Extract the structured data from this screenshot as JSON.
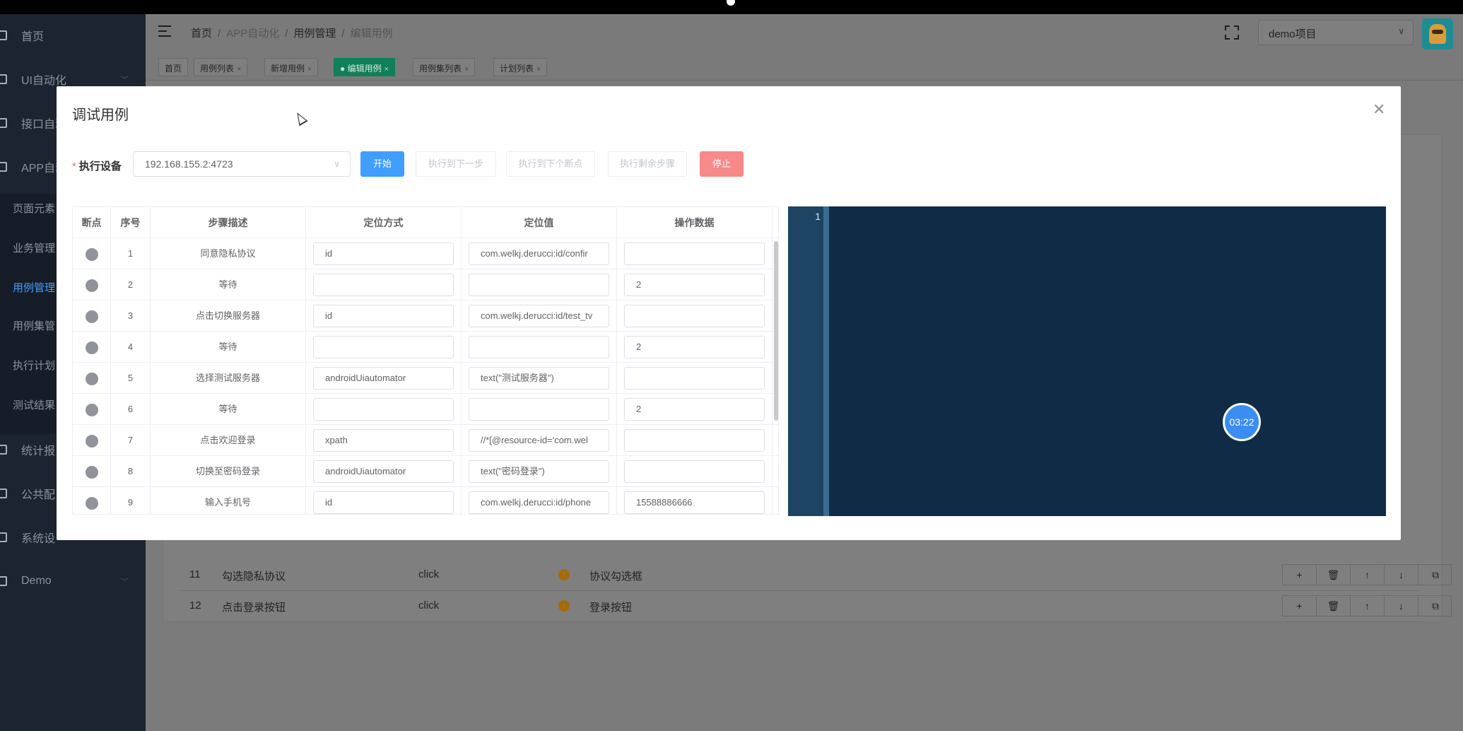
{
  "header": {
    "breadcrumb": [
      "首页",
      "APP自动化",
      "用例管理",
      "编辑用例"
    ],
    "project": "demo项目"
  },
  "sidebar": {
    "items": [
      {
        "label": "首页"
      },
      {
        "label": "UI自动化"
      },
      {
        "label": "接口自动"
      },
      {
        "label": "APP自动"
      },
      {
        "label": "统计报"
      },
      {
        "label": "公共配"
      },
      {
        "label": "系统设"
      },
      {
        "label": "Demo"
      }
    ],
    "subitems": [
      {
        "label": "页面元素"
      },
      {
        "label": "业务管理"
      },
      {
        "label": "用例管理"
      },
      {
        "label": "用例集管"
      },
      {
        "label": "执行计划"
      },
      {
        "label": "测试结果"
      }
    ]
  },
  "tags": [
    {
      "label": "首页",
      "closable": false
    },
    {
      "label": "用例列表",
      "closable": true
    },
    {
      "label": "新增用例",
      "closable": true
    },
    {
      "label": "编辑用例",
      "closable": true,
      "active": true
    },
    {
      "label": "用例集列表",
      "closable": true
    },
    {
      "label": "计划列表",
      "closable": true
    }
  ],
  "background_rows": [
    {
      "no": "11",
      "desc": "勾选隐私协议",
      "action": "click",
      "element": "协议勾选框"
    },
    {
      "no": "12",
      "desc": "点击登录按钮",
      "action": "click",
      "element": "登录按钮"
    }
  ],
  "modal": {
    "title": "调试用例",
    "device_label": "执行设备",
    "device_value": "192.168.155.2:4723",
    "buttons": {
      "start": "开始",
      "next_step": "执行到下一步",
      "next_breakpoint": "执行到下个断点",
      "remaining": "执行剩余步骤",
      "stop": "停止"
    },
    "columns": [
      "断点",
      "序号",
      "步骤描述",
      "定位方式",
      "定位值",
      "操作数据"
    ],
    "rows": [
      {
        "no": "1",
        "desc": "同意隐私协议",
        "locator": "id",
        "value": "com.welkj.derucci:id/confir",
        "data": ""
      },
      {
        "no": "2",
        "desc": "等待",
        "locator": "",
        "value": "",
        "data": "2"
      },
      {
        "no": "3",
        "desc": "点击切换服务器",
        "locator": "id",
        "value": "com.welkj.derucci:id/test_tv",
        "data": ""
      },
      {
        "no": "4",
        "desc": "等待",
        "locator": "",
        "value": "",
        "data": "2"
      },
      {
        "no": "5",
        "desc": "选择测试服务器",
        "locator": "androidUiautomator",
        "value": "text(\"测试服务器\")",
        "data": ""
      },
      {
        "no": "6",
        "desc": "等待",
        "locator": "",
        "value": "",
        "data": "2"
      },
      {
        "no": "7",
        "desc": "点击欢迎登录",
        "locator": "xpath",
        "value": "//*[@resource-id='com.wel",
        "data": ""
      },
      {
        "no": "8",
        "desc": "切换至密码登录",
        "locator": "androidUiautomator",
        "value": "text(\"密码登录\")",
        "data": ""
      },
      {
        "no": "9",
        "desc": "输入手机号",
        "locator": "id",
        "value": "com.welkj.derucci:id/phone",
        "data": "15588886666"
      }
    ],
    "editor": {
      "line_number": "1",
      "timer": "03:22"
    }
  },
  "colors": {
    "primary": "#409eff",
    "danger": "#f78989",
    "active_tag": "#10805a",
    "editor_bg": "#0f2b45"
  }
}
